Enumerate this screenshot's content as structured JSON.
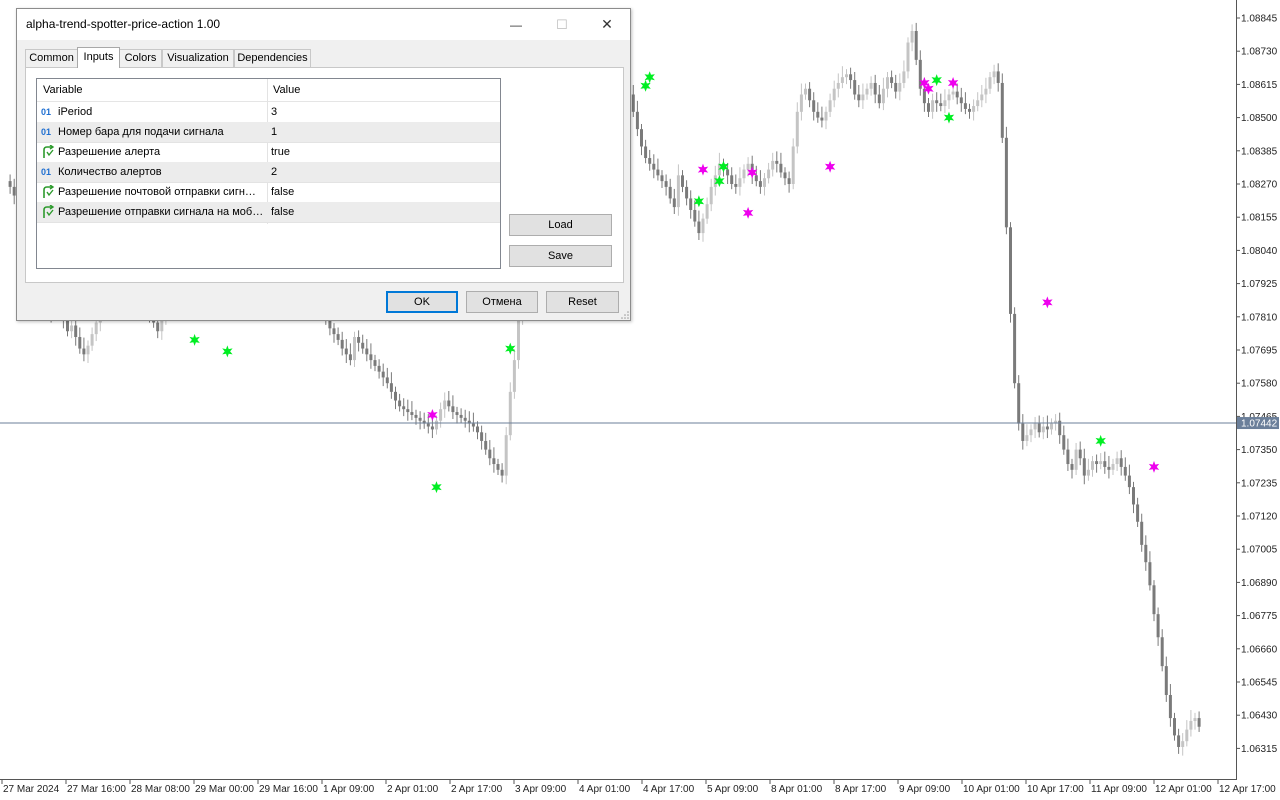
{
  "window": {
    "title": "alpha-trend-spotter-price-action 1.00",
    "minimize_glyph": "—",
    "maximize_glyph": "☐",
    "close_glyph": "✕"
  },
  "tabs": [
    {
      "label": "Common",
      "active": false
    },
    {
      "label": "Inputs",
      "active": true
    },
    {
      "label": "Colors",
      "active": false
    },
    {
      "label": "Visualization",
      "active": false
    },
    {
      "label": "Dependencies",
      "active": false
    }
  ],
  "grid": {
    "header": {
      "variable": "Variable",
      "value": "Value"
    },
    "rows": [
      {
        "icon": "int-icon",
        "variable": "iPeriod",
        "value": "3"
      },
      {
        "icon": "int-icon",
        "variable": "Номер бара для подачи сигнала",
        "value": "1"
      },
      {
        "icon": "bool-icon",
        "variable": "Разрешение алерта",
        "value": "true"
      },
      {
        "icon": "int-icon",
        "variable": "Количество алертов",
        "value": "2"
      },
      {
        "icon": "bool-icon",
        "variable": "Разрешение почтовой отправки сигн…",
        "value": "false"
      },
      {
        "icon": "bool-icon",
        "variable": "Разрешение отправки сигнала на моб…",
        "value": "false"
      }
    ]
  },
  "buttons": {
    "load": "Load",
    "save": "Save",
    "ok": "OK",
    "cancel": "Отмена",
    "reset": "Reset"
  },
  "colors": {
    "bull_signal": "#00ee22",
    "bear_signal": "#ee00ee",
    "candle_dark": "#7a7a7a",
    "candle_light": "#c4c4c4",
    "bid_line": "#6b7f9a",
    "accent": "#0078d7"
  },
  "chart_data": {
    "type": "candlestick",
    "symbol_hint": "EURUSD",
    "price_axis_labels": [
      "1.08845",
      "1.08730",
      "1.08615",
      "1.08500",
      "1.08385",
      "1.08270",
      "1.08155",
      "1.08040",
      "1.07925",
      "1.07810",
      "1.07695",
      "1.07580",
      "1.07465",
      "1.07350",
      "1.07235",
      "1.07120",
      "1.07005",
      "1.06890",
      "1.06775",
      "1.06660",
      "1.06545",
      "1.06430",
      "1.06315"
    ],
    "current_price": "1.07442",
    "time_axis_labels": [
      "27 Mar 2024",
      "27 Mar 16:00",
      "28 Mar 08:00",
      "29 Mar 00:00",
      "29 Mar 16:00",
      "1 Apr 09:00",
      "2 Apr 01:00",
      "2 Apr 17:00",
      "3 Apr 09:00",
      "4 Apr 01:00",
      "4 Apr 17:00",
      "5 Apr 09:00",
      "8 Apr 01:00",
      "8 Apr 17:00",
      "9 Apr 09:00",
      "10 Apr 01:00",
      "10 Apr 17:00",
      "11 Apr 09:00",
      "12 Apr 01:00",
      "12 Apr 17:00"
    ],
    "closes": [
      1.0828,
      1.0826,
      1.0823,
      1.0819,
      1.0815,
      1.0812,
      1.0806,
      1.0799,
      1.0794,
      1.079,
      1.0786,
      1.0782,
      1.0785,
      1.0783,
      1.078,
      1.0776,
      1.0778,
      1.0774,
      1.077,
      1.0768,
      1.0771,
      1.0775,
      1.0779,
      1.0783,
      1.0787,
      1.079,
      1.0792,
      1.0789,
      1.0786,
      1.0784,
      1.0782,
      1.0784,
      1.0786,
      1.0788,
      1.0785,
      1.0782,
      1.0779,
      1.0776,
      1.078,
      1.0784,
      1.0789,
      1.0793,
      1.0797,
      1.0801,
      1.0805,
      1.0808,
      1.0811,
      1.0813,
      1.0815,
      1.0817,
      1.0819,
      1.082,
      1.0822,
      1.0823,
      1.0825,
      1.0826,
      1.0828,
      1.0829,
      1.083,
      1.0828,
      1.0826,
      1.0824,
      1.0822,
      1.082,
      1.0818,
      1.0816,
      1.0814,
      1.0812,
      1.081,
      1.0807,
      1.0804,
      1.0801,
      1.0798,
      1.0795,
      1.0792,
      1.0789,
      1.0786,
      1.0783,
      1.078,
      1.0777,
      1.0775,
      1.0773,
      1.077,
      1.0768,
      1.0766,
      1.0774,
      1.0772,
      1.077,
      1.0768,
      1.0766,
      1.0764,
      1.0762,
      1.076,
      1.0758,
      1.0755,
      1.0752,
      1.075,
      1.0749,
      1.0748,
      1.0747,
      1.0746,
      1.0745,
      1.0744,
      1.0743,
      1.0742,
      1.0745,
      1.0749,
      1.0752,
      1.075,
      1.0748,
      1.0747,
      1.0746,
      1.0745,
      1.0744,
      1.0743,
      1.0741,
      1.0738,
      1.0735,
      1.0732,
      1.073,
      1.0728,
      1.0726,
      1.074,
      1.0755,
      1.0766,
      1.078,
      1.079,
      1.0797,
      1.08,
      1.0802,
      1.0804,
      1.0806,
      1.0808,
      1.0811,
      1.0814,
      1.0817,
      1.082,
      1.0823,
      1.0826,
      1.0829,
      1.0832,
      1.0835,
      1.0838,
      1.0842,
      1.0845,
      1.0848,
      1.0852,
      1.0856,
      1.086,
      1.0864,
      1.0868,
      1.087,
      1.0858,
      1.0852,
      1.0846,
      1.084,
      1.0836,
      1.0834,
      1.0832,
      1.083,
      1.0828,
      1.0826,
      1.0822,
      1.0819,
      1.083,
      1.0826,
      1.0822,
      1.0818,
      1.0814,
      1.081,
      1.0815,
      1.082,
      1.0826,
      1.083,
      1.0834,
      1.0832,
      1.083,
      1.0827,
      1.0826,
      1.0829,
      1.0832,
      1.0834,
      1.083,
      1.0828,
      1.0826,
      1.0829,
      1.0832,
      1.0835,
      1.0834,
      1.0831,
      1.0829,
      1.0827,
      1.084,
      1.0852,
      1.0858,
      1.086,
      1.0856,
      1.0852,
      1.085,
      1.0849,
      1.0852,
      1.0856,
      1.086,
      1.0862,
      1.0864,
      1.0865,
      1.0863,
      1.0858,
      1.0856,
      1.0858,
      1.086,
      1.0862,
      1.0858,
      1.0855,
      1.086,
      1.0864,
      1.0862,
      1.0859,
      1.0862,
      1.0866,
      1.0876,
      1.088,
      1.087,
      1.086,
      1.0855,
      1.0852,
      1.0856,
      1.0855,
      1.0854,
      1.0856,
      1.0858,
      1.0859,
      1.0857,
      1.0855,
      1.0853,
      1.0852,
      1.0854,
      1.0856,
      1.0858,
      1.086,
      1.0864,
      1.0866,
      1.0862,
      1.0843,
      1.0812,
      1.0782,
      1.0758,
      1.0744,
      1.0738,
      1.074,
      1.0742,
      1.0744,
      1.0741,
      1.0743,
      1.0742,
      1.0744,
      1.0745,
      1.074,
      1.0735,
      1.073,
      1.0728,
      1.0735,
      1.0732,
      1.0726,
      1.0728,
      1.0731,
      1.073,
      1.0731,
      1.0729,
      1.0728,
      1.073,
      1.0732,
      1.0729,
      1.0726,
      1.0722,
      1.0716,
      1.071,
      1.0702,
      1.0696,
      1.0688,
      1.0678,
      1.067,
      1.066,
      1.065,
      1.0642,
      1.0636,
      1.0632,
      1.0634,
      1.0638,
      1.0641,
      1.0642,
      1.0639
    ],
    "signals": [
      {
        "type": "buy",
        "bar": 46,
        "price": 1.0773
      },
      {
        "type": "buy",
        "bar": 54,
        "price": 1.0769
      },
      {
        "type": "sell",
        "bar": 104,
        "price": 1.0747
      },
      {
        "type": "buy",
        "bar": 105,
        "price": 1.0722
      },
      {
        "type": "buy",
        "bar": 123,
        "price": 1.077
      },
      {
        "type": "buy",
        "bar": 156,
        "price": 1.0861
      },
      {
        "type": "buy",
        "bar": 157,
        "price": 1.0864
      },
      {
        "type": "buy",
        "bar": 169,
        "price": 1.0821
      },
      {
        "type": "sell",
        "bar": 170,
        "price": 1.0832
      },
      {
        "type": "buy",
        "bar": 174,
        "price": 1.0828
      },
      {
        "type": "buy",
        "bar": 175,
        "price": 1.0833
      },
      {
        "type": "sell",
        "bar": 181,
        "price": 1.0817
      },
      {
        "type": "sell",
        "bar": 182,
        "price": 1.0831
      },
      {
        "type": "sell",
        "bar": 201,
        "price": 1.0833
      },
      {
        "type": "sell",
        "bar": 224,
        "price": 1.0862
      },
      {
        "type": "sell",
        "bar": 225,
        "price": 1.086
      },
      {
        "type": "buy",
        "bar": 227,
        "price": 1.0863
      },
      {
        "type": "buy",
        "bar": 230,
        "price": 1.085
      },
      {
        "type": "sell",
        "bar": 231,
        "price": 1.0862
      },
      {
        "type": "sell",
        "bar": 254,
        "price": 1.0786
      },
      {
        "type": "buy",
        "bar": 267,
        "price": 1.0738
      },
      {
        "type": "sell",
        "bar": 280,
        "price": 1.0729
      }
    ]
  }
}
